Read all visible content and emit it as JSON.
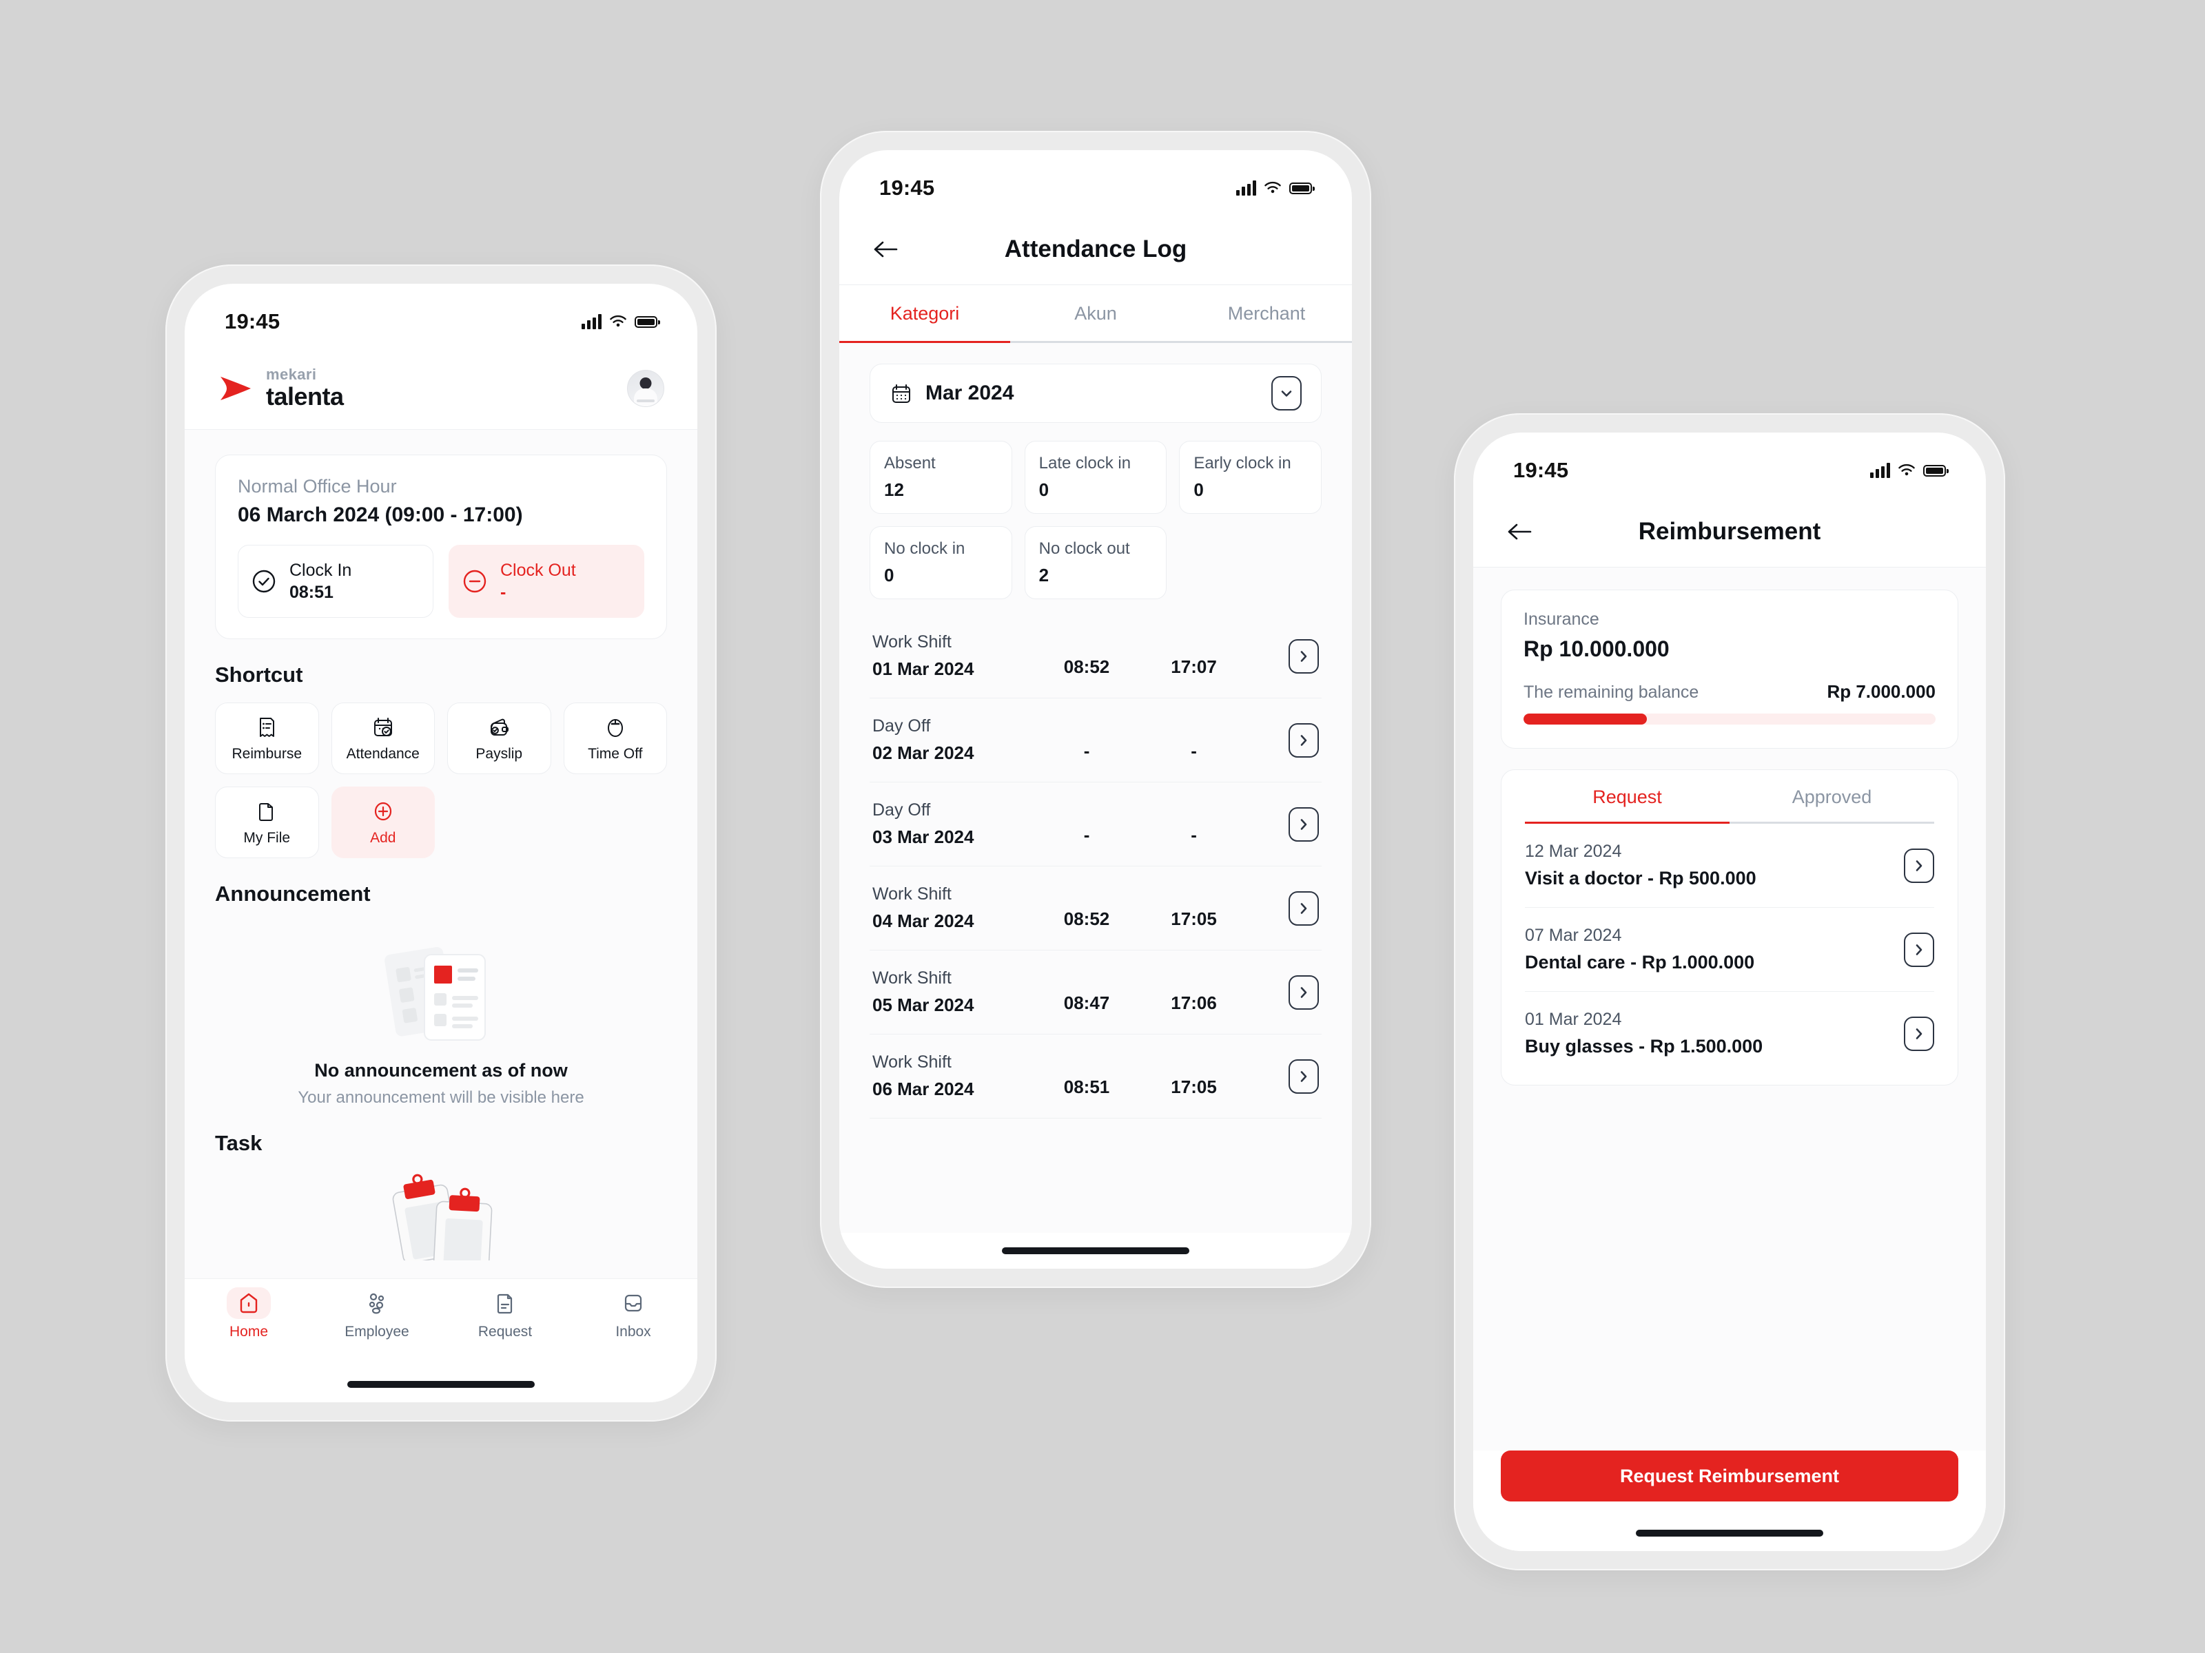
{
  "status_bar": {
    "time": "19:45"
  },
  "brand": {
    "top": "mekari",
    "bottom": "talenta"
  },
  "colors": {
    "accent": "#e42320",
    "accent_soft": "#fdeeee",
    "text": "#11151b",
    "muted": "#8b95a3"
  },
  "home": {
    "office_hour": {
      "label": "Normal Office Hour",
      "date_range": "06 March 2024 (09:00 - 17:00)",
      "clock_in": {
        "label": "Clock In",
        "value": "08:51"
      },
      "clock_out": {
        "label": "Clock Out",
        "value": "-"
      }
    },
    "shortcut_title": "Shortcut",
    "shortcuts": [
      {
        "label": "Reimburse",
        "icon": "receipt-icon"
      },
      {
        "label": "Attendance",
        "icon": "calendar-check-icon"
      },
      {
        "label": "Payslip",
        "icon": "wallet-check-icon"
      },
      {
        "label": "Time Off",
        "icon": "clock-oval-icon"
      },
      {
        "label": "My File",
        "icon": "file-folder-icon"
      },
      {
        "label": "Add",
        "icon": "plus-circle-icon"
      }
    ],
    "announcement_title": "Announcement",
    "announcement_empty_title": "No announcement as of now",
    "announcement_empty_sub": "Your announcement will be visible here",
    "task_title": "Task",
    "tabs": [
      {
        "label": "Home",
        "icon": "home-icon",
        "active": true
      },
      {
        "label": "Employee",
        "icon": "people-icon",
        "active": false
      },
      {
        "label": "Request",
        "icon": "document-icon",
        "active": false
      },
      {
        "label": "Inbox",
        "icon": "inbox-icon",
        "active": false
      }
    ]
  },
  "attendance": {
    "title": "Attendance Log",
    "back_icon": "arrow-left-icon",
    "tabs": [
      {
        "label": "Kategori",
        "active": true
      },
      {
        "label": "Akun",
        "active": false
      },
      {
        "label": "Merchant",
        "active": false
      }
    ],
    "month": {
      "value": "Mar 2024",
      "icon": "calendar-icon",
      "chevron": "chevron-down-icon"
    },
    "stats": [
      {
        "label": "Absent",
        "value": "12"
      },
      {
        "label": "Late clock in",
        "value": "0"
      },
      {
        "label": "Early clock in",
        "value": "0"
      },
      {
        "label": "No clock in",
        "value": "0"
      },
      {
        "label": "No clock out",
        "value": "2"
      }
    ],
    "log": [
      {
        "type": "Work Shift",
        "date": "01 Mar 2024",
        "in": "08:52",
        "out": "17:07"
      },
      {
        "type": "Day Off",
        "date": "02 Mar 2024",
        "in": "-",
        "out": "-"
      },
      {
        "type": "Day Off",
        "date": "03 Mar 2024",
        "in": "-",
        "out": "-"
      },
      {
        "type": "Work Shift",
        "date": "04 Mar 2024",
        "in": "08:52",
        "out": "17:05"
      },
      {
        "type": "Work Shift",
        "date": "05 Mar 2024",
        "in": "08:47",
        "out": "17:06"
      },
      {
        "type": "Work Shift",
        "date": "06 Mar 2024",
        "in": "08:51",
        "out": "17:05"
      }
    ]
  },
  "reimbursement": {
    "title": "Reimbursement",
    "back_icon": "arrow-left-icon",
    "balance": {
      "name": "Insurance",
      "total": "Rp 10.000.000",
      "remaining_label": "The remaining balance",
      "remaining_value": "Rp 7.000.000",
      "progress_percent": 30
    },
    "tabs": [
      {
        "label": "Request",
        "active": true
      },
      {
        "label": "Approved",
        "active": false
      }
    ],
    "requests": [
      {
        "date": "12 Mar 2024",
        "desc": "Visit a doctor - Rp 500.000"
      },
      {
        "date": "07 Mar 2024",
        "desc": "Dental care - Rp 1.000.000"
      },
      {
        "date": "01 Mar 2024",
        "desc": "Buy glasses - Rp 1.500.000"
      }
    ],
    "cta_label": "Request Reimbursement"
  }
}
